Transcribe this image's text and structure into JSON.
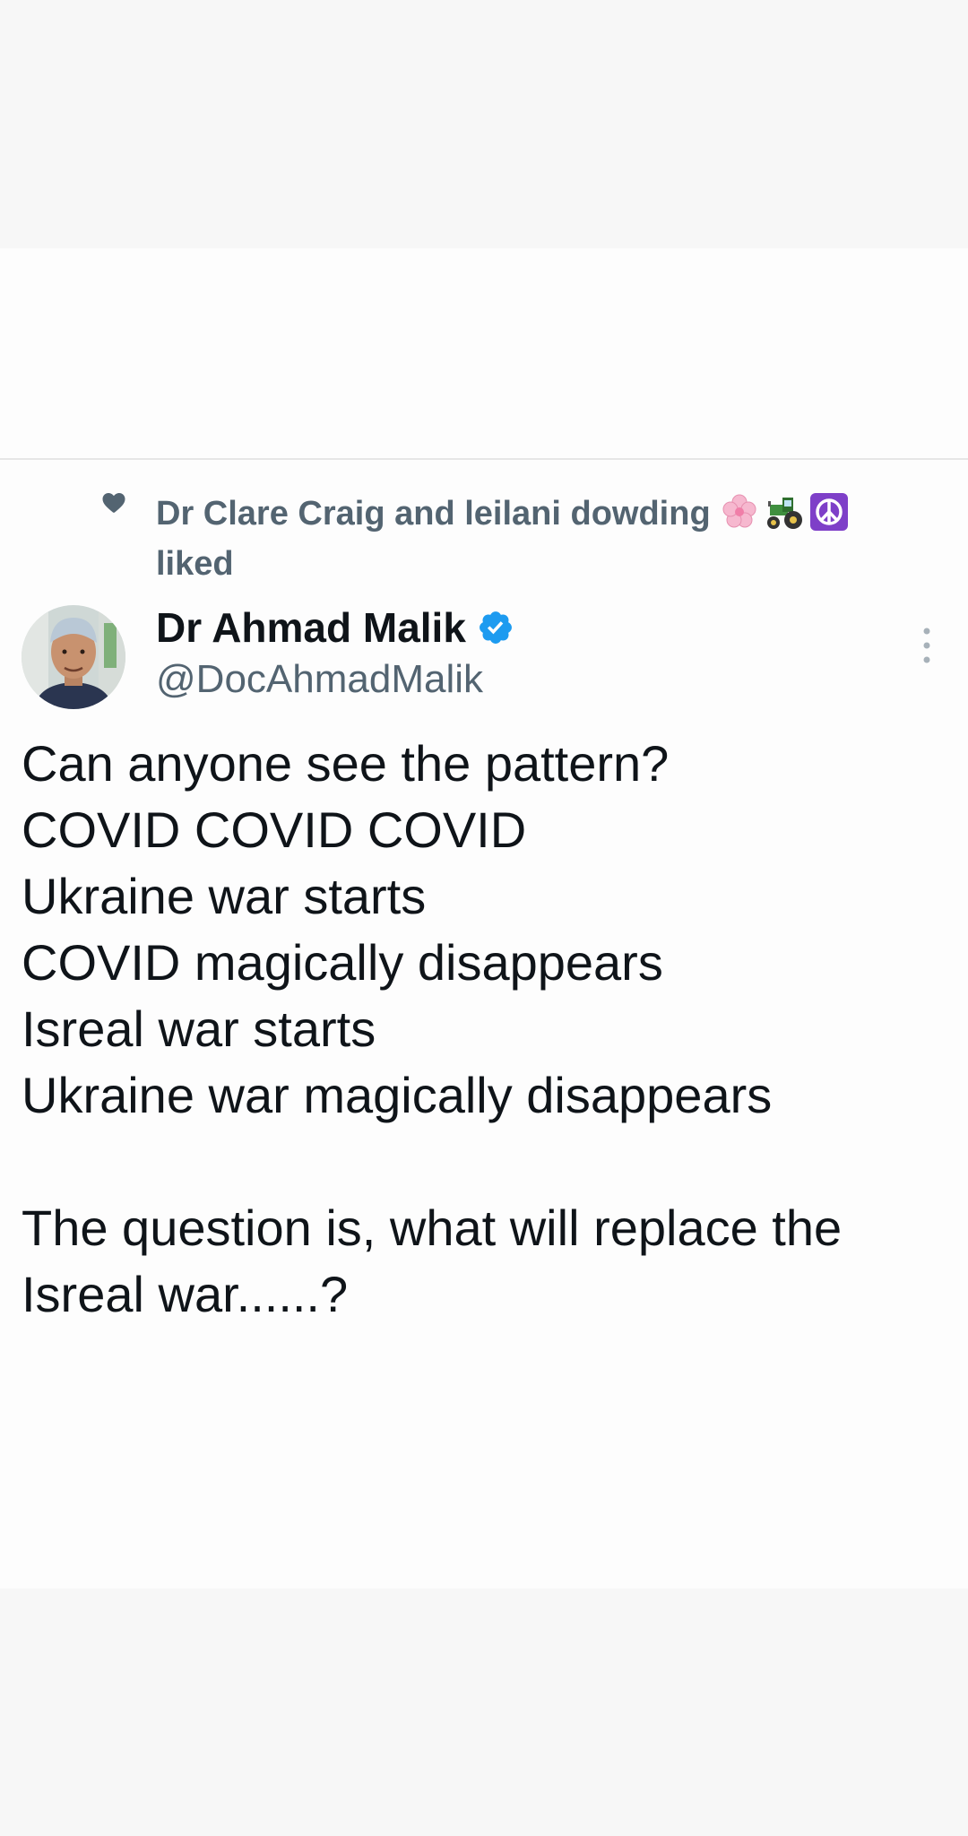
{
  "social_context": {
    "text": "Dr Clare Craig and leilani dowding",
    "suffix": "liked",
    "emojis": [
      "cherry-blossom-icon",
      "tractor-icon",
      "peace-symbol-icon"
    ]
  },
  "author": {
    "name": "Dr Ahmad Malik",
    "handle": "@DocAhmadMalik",
    "verified": true
  },
  "tweet": {
    "lines": [
      "Can anyone see the pattern?",
      "COVID COVID COVID",
      "Ukraine war starts",
      "COVID magically disappears",
      "Isreal war starts",
      "Ukraine war magically disappears",
      "",
      "The question is, what will replace the Isreal war......?"
    ]
  },
  "colors": {
    "verified": "#1d9bf0",
    "secondary_text": "#536471",
    "primary_text": "#0f1419",
    "peace_bg": "#7e3fc8"
  }
}
